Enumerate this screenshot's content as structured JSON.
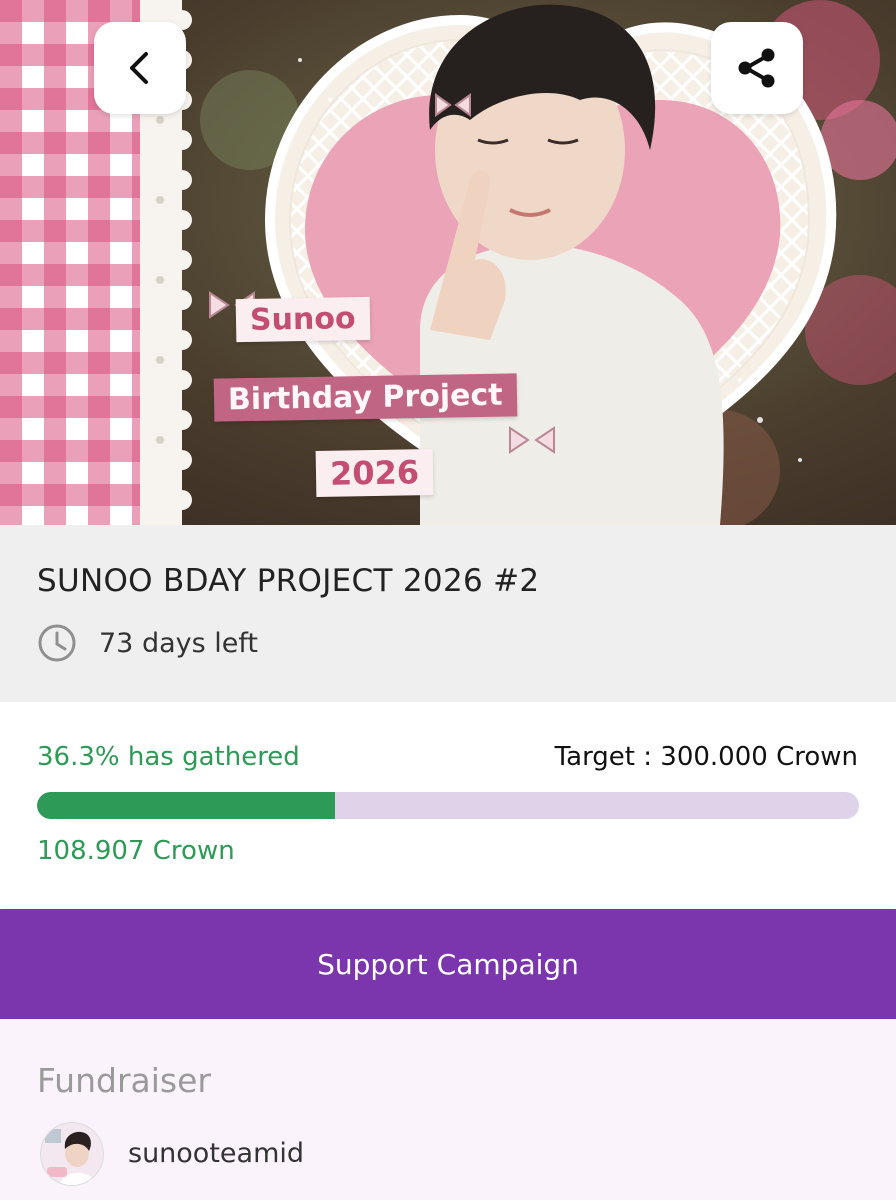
{
  "banner": {
    "title_line1": "Sunoo",
    "title_line2": "Birthday Project",
    "title_line3": "2026"
  },
  "nav": {
    "back_icon": "chevron-left-icon",
    "share_icon": "share-icon"
  },
  "campaign": {
    "title": "SUNOO BDAY PROJECT 2026 #2",
    "clock_icon": "clock-icon",
    "days_left": "73 days left"
  },
  "progress": {
    "gathered_label": "36.3% has gathered",
    "target_label": "Target : 300.000 Crown",
    "collected_label": "108.907 Crown",
    "fraction": 0.363,
    "fill_color": "#2e9a57",
    "track_color": "#dfd3ea"
  },
  "support": {
    "button_label": "Support Campaign",
    "color": "#7b35ad"
  },
  "fundraiser": {
    "heading": "Fundraiser",
    "name": "sunooteamid"
  }
}
